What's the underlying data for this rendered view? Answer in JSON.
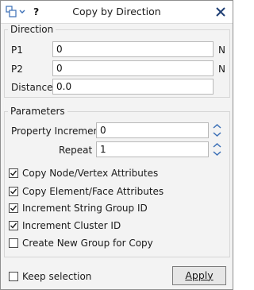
{
  "window": {
    "title": "Copy by Direction",
    "help_label": "?"
  },
  "direction": {
    "label": "Direction",
    "p1_label": "P1",
    "p1_value": "0",
    "p1_unit": "N",
    "p2_label": "P2",
    "p2_value": "0",
    "p2_unit": "N",
    "distance_label": "Distance",
    "distance_value": "0.0"
  },
  "parameters": {
    "label": "Parameters",
    "property_increment_label": "Property Increment",
    "property_increment_value": "0",
    "repeat_label": "Repeat",
    "repeat_value": "1",
    "checkboxes": [
      {
        "label": "Copy Node/Vertex Attributes",
        "checked": true
      },
      {
        "label": "Copy Element/Face Attributes",
        "checked": true
      },
      {
        "label": "Increment String Group ID",
        "checked": true
      },
      {
        "label": "Increment Cluster ID",
        "checked": true
      },
      {
        "label": "Create New Group for Copy",
        "checked": false
      }
    ]
  },
  "footer": {
    "keep_selection_label": "Keep selection",
    "keep_selection_checked": false,
    "apply_label": "Apply"
  }
}
